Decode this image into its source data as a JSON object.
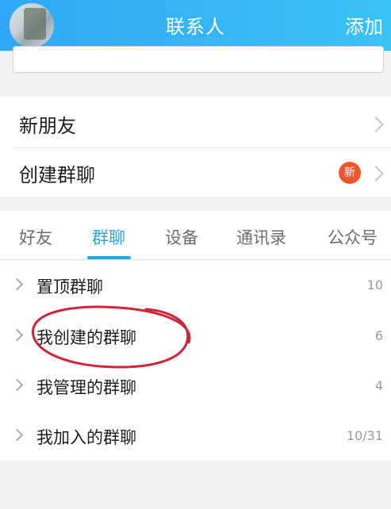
{
  "header": {
    "title": "联系人",
    "add_label": "添加"
  },
  "menu": {
    "new_friends": "新朋友",
    "create_group": "创建群聊",
    "create_group_badge": "新"
  },
  "tabs": [
    {
      "label": "好友",
      "active": false
    },
    {
      "label": "群聊",
      "active": true
    },
    {
      "label": "设备",
      "active": false
    },
    {
      "label": "通讯录",
      "active": false
    },
    {
      "label": "公众号",
      "active": false
    }
  ],
  "groups": [
    {
      "label": "置顶群聊",
      "count": "10"
    },
    {
      "label": "我创建的群聊",
      "count": "6"
    },
    {
      "label": "我管理的群聊",
      "count": "4"
    },
    {
      "label": "我加入的群聊",
      "count": "10/31"
    }
  ],
  "colors": {
    "header_gradient_start": "#2fa8f7",
    "header_gradient_end": "#38c3f5",
    "accent": "#2aa4e8",
    "badge": "#f2552c",
    "annotation": "#d0243a"
  }
}
